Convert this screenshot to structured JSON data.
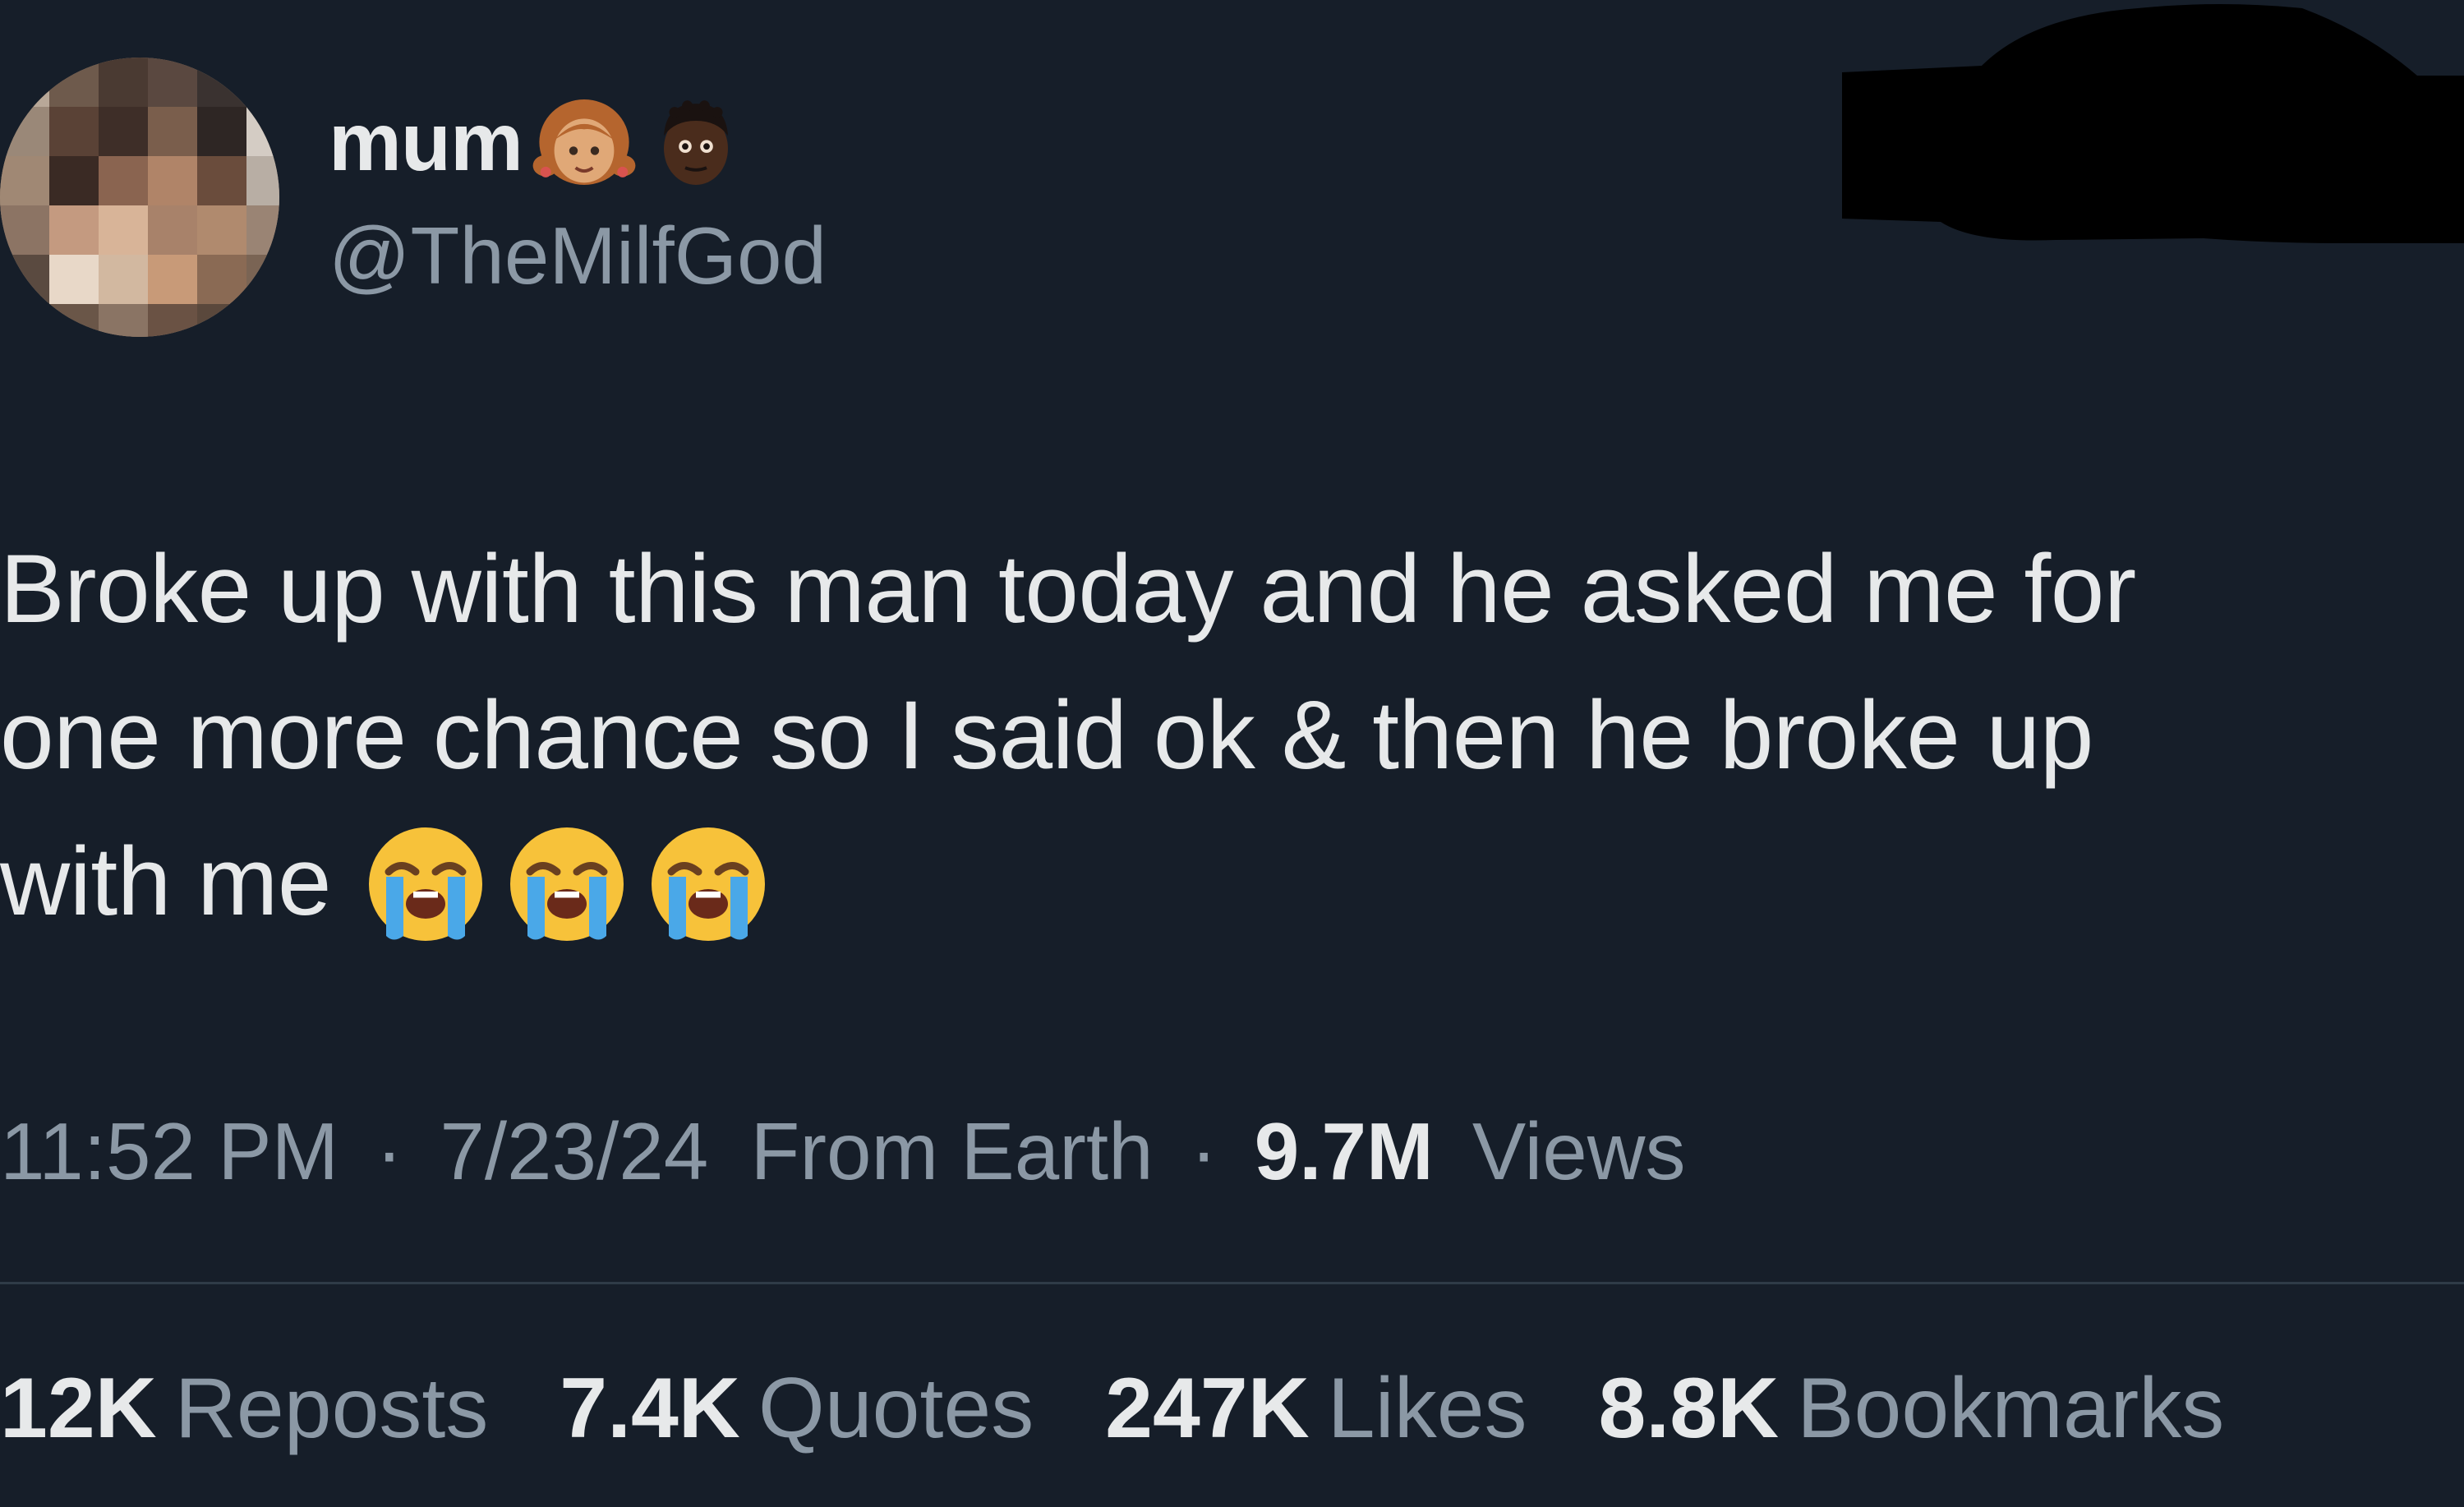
{
  "user": {
    "display_name": "mum",
    "handle": "@TheMilfGod",
    "name_emojis": [
      "girl-emoji",
      "man-dark-skin-emoji"
    ]
  },
  "tweet": {
    "lines": [
      "Broke up with this man today and he asked me for",
      "one more chance so I said ok & then he broke up",
      "with me"
    ],
    "trailing_emojis": [
      "loudly-crying-face",
      "loudly-crying-face",
      "loudly-crying-face"
    ]
  },
  "meta": {
    "time": "11:52 PM",
    "sep": "·",
    "date": "7/23/24",
    "source": "From Earth",
    "views_count": "9.7M",
    "views_label": "Views"
  },
  "stats": {
    "reposts_count": "12K",
    "reposts_label": "Reposts",
    "quotes_count": "7.4K",
    "quotes_label": "Quotes",
    "likes_count": "247K",
    "likes_label": "Likes",
    "bookmarks_count": "8.8K",
    "bookmarks_label": "Bookmarks"
  },
  "colors": {
    "background": "#161e29",
    "primary_text": "#e7e9ea",
    "secondary_text": "#8b98a5",
    "divider": "#2f3b47"
  }
}
